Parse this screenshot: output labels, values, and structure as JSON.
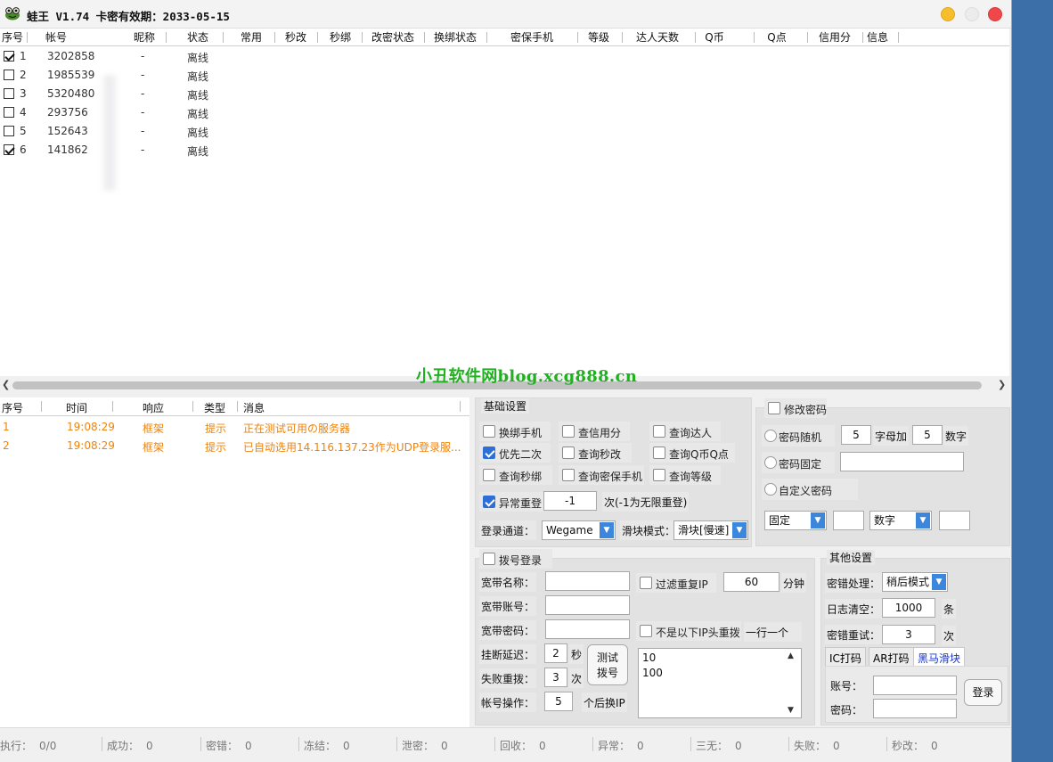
{
  "window": {
    "title": "蛙王 V1.74 卡密有效期：2033-05-15",
    "icon": "frog-icon"
  },
  "accounts_table": {
    "columns": [
      "序号",
      "帐号",
      "昵称",
      "状态",
      "常用",
      "秒改",
      "秒绑",
      "改密状态",
      "换绑状态",
      "密保手机",
      "等级",
      "达人天数",
      "Q币",
      "Q点",
      "信用分",
      "信息"
    ],
    "rows": [
      {
        "checked": true,
        "index": "1",
        "account": "3202858",
        "nickname": "-",
        "status": "离线"
      },
      {
        "checked": false,
        "index": "2",
        "account": "1985539",
        "nickname": "-",
        "status": "离线"
      },
      {
        "checked": false,
        "index": "3",
        "account": "5320480",
        "nickname": "-",
        "status": "离线"
      },
      {
        "checked": false,
        "index": "4",
        "account": "293756",
        "nickname": "-",
        "status": "离线"
      },
      {
        "checked": false,
        "index": "5",
        "account": "152643",
        "nickname": "-",
        "status": "离线"
      },
      {
        "checked": true,
        "index": "6",
        "account": "141862",
        "nickname": "-",
        "status": "离线"
      }
    ]
  },
  "watermark": "小丑软件网blog.xcg888.cn",
  "log_table": {
    "columns": [
      "序号",
      "时间",
      "响应",
      "类型",
      "消息"
    ],
    "rows": [
      {
        "index": "1",
        "time": "19:08:29",
        "response": "框架",
        "type": "提示",
        "message": "正在测试可用の服务器"
      },
      {
        "index": "2",
        "time": "19:08:29",
        "response": "框架",
        "type": "提示",
        "message": "已自动选用14.116.137.23作为UDP登录服..."
      }
    ]
  },
  "basic_settings": {
    "title": "基础设置",
    "checks": {
      "swap_phone": {
        "label": "换绑手机",
        "checked": false
      },
      "query_credit": {
        "label": "查信用分",
        "checked": false
      },
      "query_master": {
        "label": "查询达人",
        "checked": false
      },
      "prefer_second": {
        "label": "优先二次",
        "checked": true
      },
      "query_quick_change": {
        "label": "查询秒改",
        "checked": false
      },
      "query_qcoin": {
        "label": "查询Q币Q点",
        "checked": false
      },
      "query_quick_bind": {
        "label": "查询秒绑",
        "checked": false
      },
      "query_secure_phone": {
        "label": "查询密保手机",
        "checked": false
      },
      "query_level": {
        "label": "查询等级",
        "checked": false
      },
      "retry_on_error": {
        "label": "异常重登",
        "checked": true
      }
    },
    "retry_value": "-1",
    "retry_suffix": "次(-1为无限重登)",
    "channel_label": "登录通道：",
    "channel_value": "Wegame",
    "slider_label": "滑块模式：",
    "slider_value": "滑块[慢速]"
  },
  "password_settings": {
    "title": "修改密码",
    "enabled": false,
    "random_label": "密码随机",
    "letters_value": "5",
    "letters_suffix": "字母加",
    "digits_value": "5",
    "digits_suffix": "数字",
    "fixed_label": "密码固定",
    "fixed_value": "",
    "custom_label": "自定义密码",
    "custom_mode_value": "固定",
    "custom_text_value": "",
    "custom_type_value": "数字",
    "custom_extra_value": ""
  },
  "dial_settings": {
    "title": "拨号登录",
    "enabled": false,
    "broadband_name_label": "宽带名称：",
    "broadband_account_label": "宽带账号：",
    "broadband_password_label": "宽带密码：",
    "hangup_delay_label": "挂断延迟：",
    "hangup_delay_value": "2",
    "hangup_delay_unit": "秒",
    "fail_redial_label": "失败重拨：",
    "fail_redial_value": "3",
    "fail_redial_unit": "次",
    "account_op_label": "帐号操作：",
    "account_op_value": "5",
    "account_op_suffix": "个后换IP",
    "test_button": "测试\n拨号",
    "filter_ip_label": "过滤重复IP",
    "filter_ip_checked": false,
    "filter_value": "60",
    "filter_unit": "分钟",
    "ip_prefix_label": "不是以下IP头重拨",
    "ip_prefix_checked": false,
    "ip_prefix_hint": "一行一个",
    "ip_prefix_list": "10\n100"
  },
  "other_settings": {
    "title": "其他设置",
    "wrong_password_label": "密错处理：",
    "wrong_password_value": "稍后模式",
    "log_clear_label": "日志清空：",
    "log_clear_value": "1000",
    "log_clear_unit": "条",
    "wrong_retry_label": "密错重试：",
    "wrong_retry_value": "3",
    "wrong_retry_unit": "次",
    "tabs": [
      "IC打码",
      "AR打码",
      "黑马滑块"
    ],
    "active_tab": 2,
    "account_label": "账号：",
    "password_label": "密码：",
    "login_button": "登录"
  },
  "status_bar": [
    {
      "label": "执行：",
      "value": "0/0"
    },
    {
      "label": "成功：",
      "value": "0"
    },
    {
      "label": "密错：",
      "value": "0"
    },
    {
      "label": "冻结：",
      "value": "0"
    },
    {
      "label": "泄密：",
      "value": "0"
    },
    {
      "label": "回收：",
      "value": "0"
    },
    {
      "label": "异常：",
      "value": "0"
    },
    {
      "label": "三无：",
      "value": "0"
    },
    {
      "label": "失败：",
      "value": "0"
    },
    {
      "label": "秒改：",
      "value": "0"
    }
  ],
  "colors": {
    "log_text": "#f0830a",
    "watermark": "#20b020",
    "accent": "#2d6fd6",
    "desktop": "#3c6ea8"
  }
}
